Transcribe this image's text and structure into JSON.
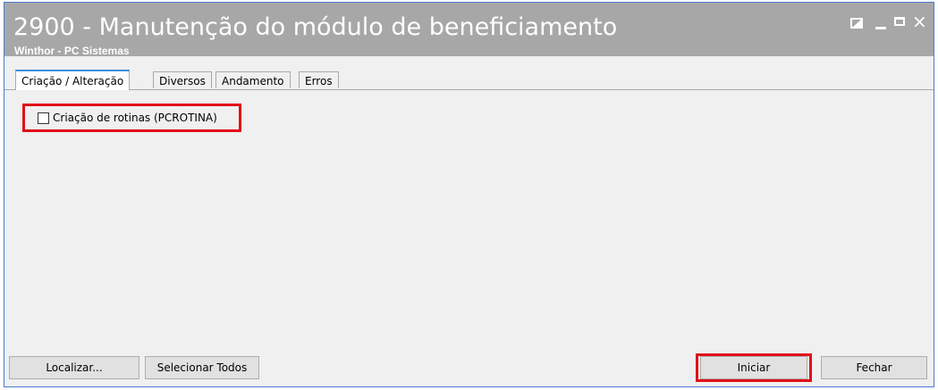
{
  "window": {
    "title": "2900 - Manutenção do módulo de beneficiamento",
    "subtitle": "Winthor - PC Sistemas",
    "controls": {
      "restore": "restore-icon",
      "minimize": "minimize-icon",
      "maximize": "maximize-icon",
      "close": "×"
    }
  },
  "tabs": [
    {
      "label": "Criação / Alteração",
      "active": true
    },
    {
      "label": "Diversos",
      "active": false
    },
    {
      "label": "Andamento",
      "active": false
    },
    {
      "label": "Erros",
      "active": false
    }
  ],
  "options": {
    "criacao_rotinas": {
      "label": "Criação de rotinas (PCROTINA)",
      "checked": false
    }
  },
  "buttons": {
    "localizar": "Localizar...",
    "selecionar_todos": "Selecionar Todos",
    "iniciar": "Iniciar",
    "fechar": "Fechar"
  },
  "colors": {
    "titlebar": "#a7a7a7",
    "highlight": "#e10f17",
    "window_border": "#4a7bd0"
  }
}
